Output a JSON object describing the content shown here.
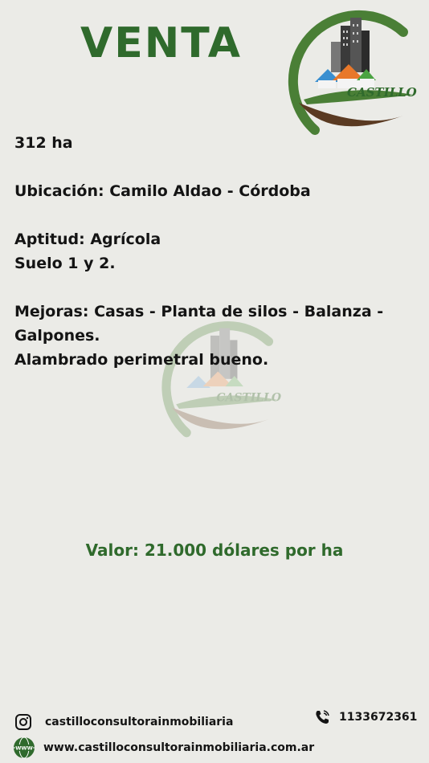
{
  "header": {
    "title": "VENTA"
  },
  "logo": {
    "text": "CASTILLO"
  },
  "details": {
    "area": "312 ha",
    "location": "Ubicación: Camilo Aldao - Córdoba",
    "aptitude": "Aptitud: Agrícola",
    "soil": "Suelo 1 y 2.",
    "improvements_line1": "Mejoras: Casas - Planta de silos - Balanza -",
    "improvements_line2": "Galpones.",
    "fencing": "Alambrado perimetral bueno."
  },
  "price": {
    "text": "Valor: 21.000 dólares por ha"
  },
  "footer": {
    "instagram": "castilloconsultorainmobiliaria",
    "phone": "1133672361",
    "website": "www.castilloconsultorainmobiliaria.com.ar",
    "web_icon_text": "WWW"
  },
  "colors": {
    "brand_green": "#2f6a2c",
    "logo_brown": "#5a3a22",
    "background": "#ebebe7"
  }
}
